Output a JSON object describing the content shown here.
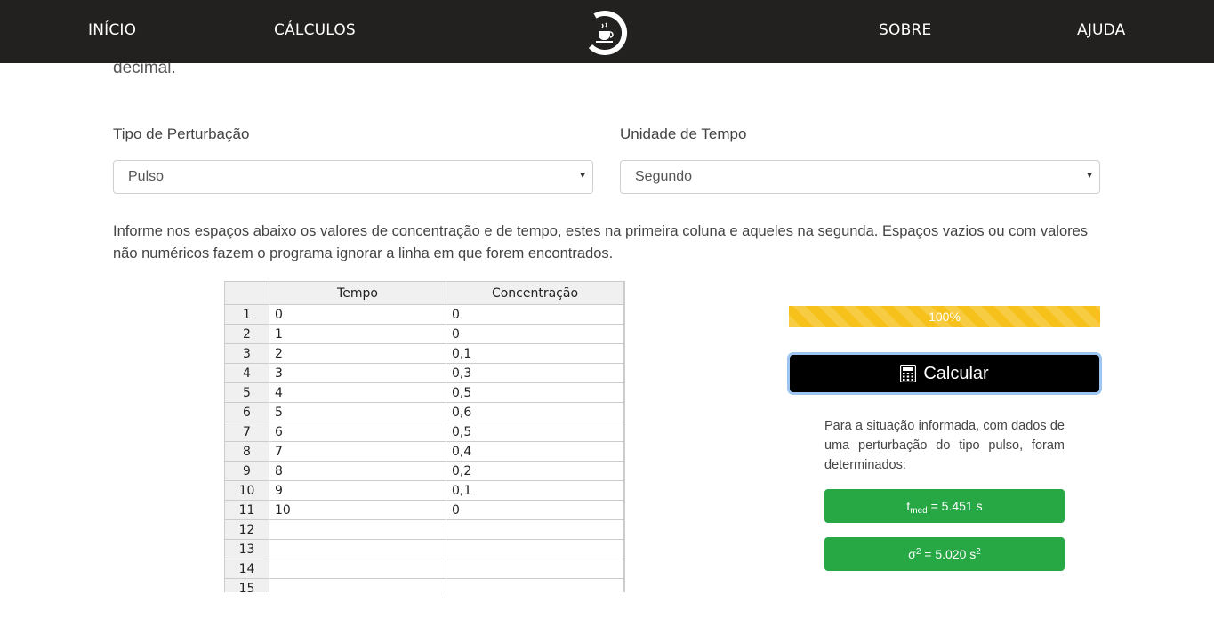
{
  "nav": {
    "inicio": "INÍCIO",
    "calculos": "CÁLCULOS",
    "sobre": "SOBRE",
    "ajuda": "AJUDA"
  },
  "intro_tail": "decimal.",
  "perturbacao": {
    "label": "Tipo de Perturbação",
    "value": "Pulso"
  },
  "tempo": {
    "label": "Unidade de Tempo",
    "value": "Segundo"
  },
  "instructions": "Informe nos espaços abaixo os valores de concentração e de tempo, estes na primeira coluna e aqueles na segunda. Espaços vazios ou com valores não numéricos fazem o programa ignorar a linha em que forem encontrados.",
  "sheet": {
    "headers": [
      "Tempo",
      "Concentração"
    ],
    "rows": [
      [
        "1",
        "0",
        "0"
      ],
      [
        "2",
        "1",
        "0"
      ],
      [
        "3",
        "2",
        "0,1"
      ],
      [
        "4",
        "3",
        "0,3"
      ],
      [
        "5",
        "4",
        "0,5"
      ],
      [
        "6",
        "5",
        "0,6"
      ],
      [
        "7",
        "6",
        "0,5"
      ],
      [
        "8",
        "7",
        "0,4"
      ],
      [
        "9",
        "8",
        "0,2"
      ],
      [
        "10",
        "9",
        "0,1"
      ],
      [
        "11",
        "10",
        "0"
      ],
      [
        "12",
        "",
        ""
      ],
      [
        "13",
        "",
        ""
      ],
      [
        "14",
        "",
        ""
      ],
      [
        "15",
        "",
        ""
      ]
    ]
  },
  "progress": {
    "label": "100%",
    "fraction": 1.0
  },
  "calc_button": "Calcular",
  "result": {
    "text": "Para a situação informada, com dados de uma perturbação do tipo pulso, foram determinados:",
    "tmed": {
      "symbol": "t",
      "subscript": "med",
      "value": " = 5.451 s"
    },
    "sigma": {
      "symbol": "σ",
      "superscript": "2",
      "value": " = 5.020 s",
      "unit_superscript": "2"
    }
  },
  "colors": {
    "navbar": "#222120",
    "progress": "#f5c11a",
    "success": "#28a745",
    "button": "#000000"
  }
}
